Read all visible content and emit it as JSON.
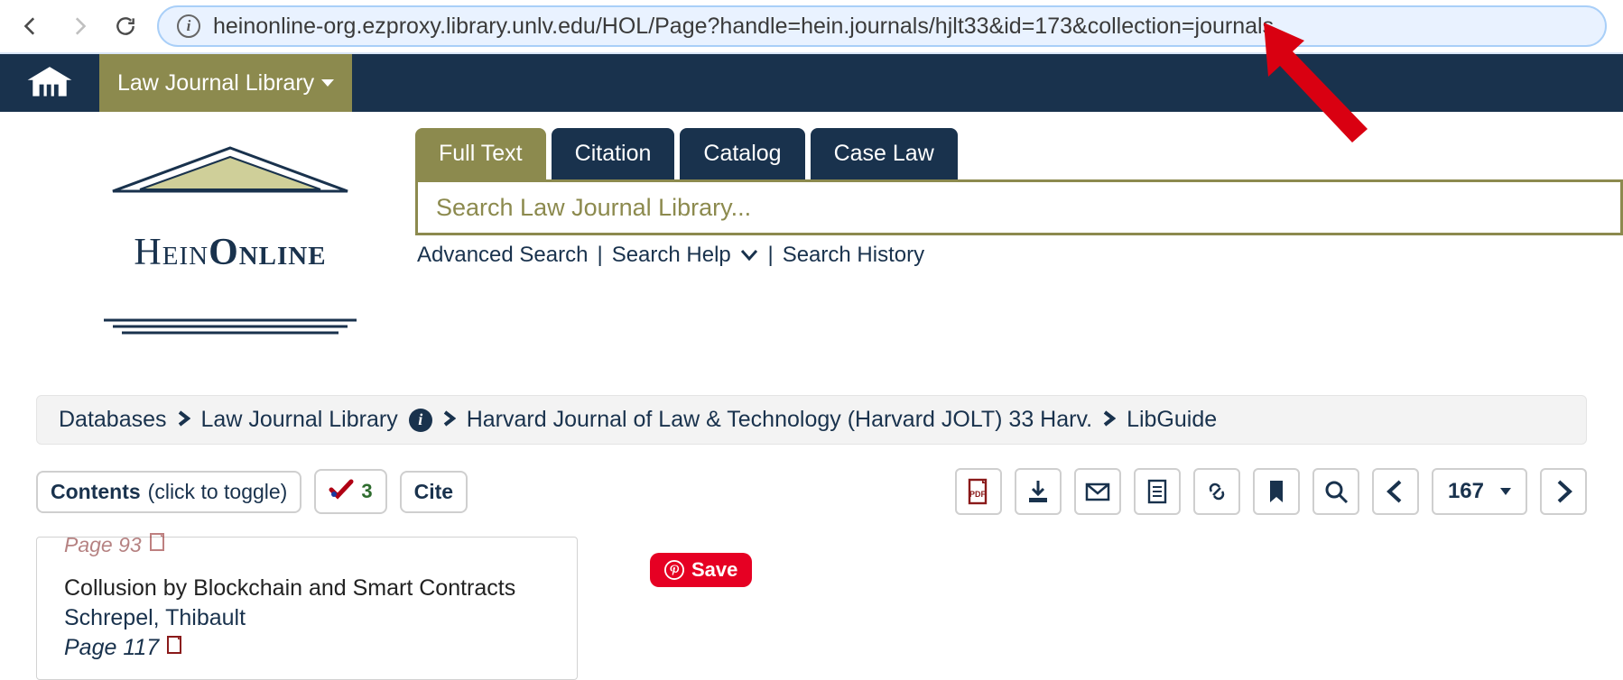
{
  "browser": {
    "url": "heinonline-org.ezproxy.library.unlv.edu/HOL/Page?handle=hein.journals/hjlt33&id=173&collection=journals"
  },
  "topbar": {
    "library_label": "Law Journal Library"
  },
  "logo": {
    "text_thin": "Hein",
    "text_bold": "Online"
  },
  "tabs": {
    "full_text": "Full Text",
    "citation": "Citation",
    "catalog": "Catalog",
    "case_law": "Case Law"
  },
  "search": {
    "placeholder": "Search Law Journal Library...",
    "advanced": "Advanced Search",
    "help": "Search Help",
    "history": "Search History"
  },
  "breadcrumb": {
    "databases": "Databases",
    "library": "Law Journal Library",
    "journal": "Harvard Journal of Law & Technology (Harvard JOLT) 33 Harv.",
    "libguide": "LibGuide"
  },
  "toolbar": {
    "contents_label": "Contents",
    "contents_sub": "(click to toggle)",
    "flag_count": "3",
    "cite_label": "Cite",
    "page_number": "167"
  },
  "contents": {
    "prev_page_line": "Page 93",
    "article_title": "Collusion by Blockchain and Smart Contracts",
    "article_author": "Schrepel, Thibault",
    "article_page": "Page 117"
  },
  "save": {
    "label": "Save"
  }
}
